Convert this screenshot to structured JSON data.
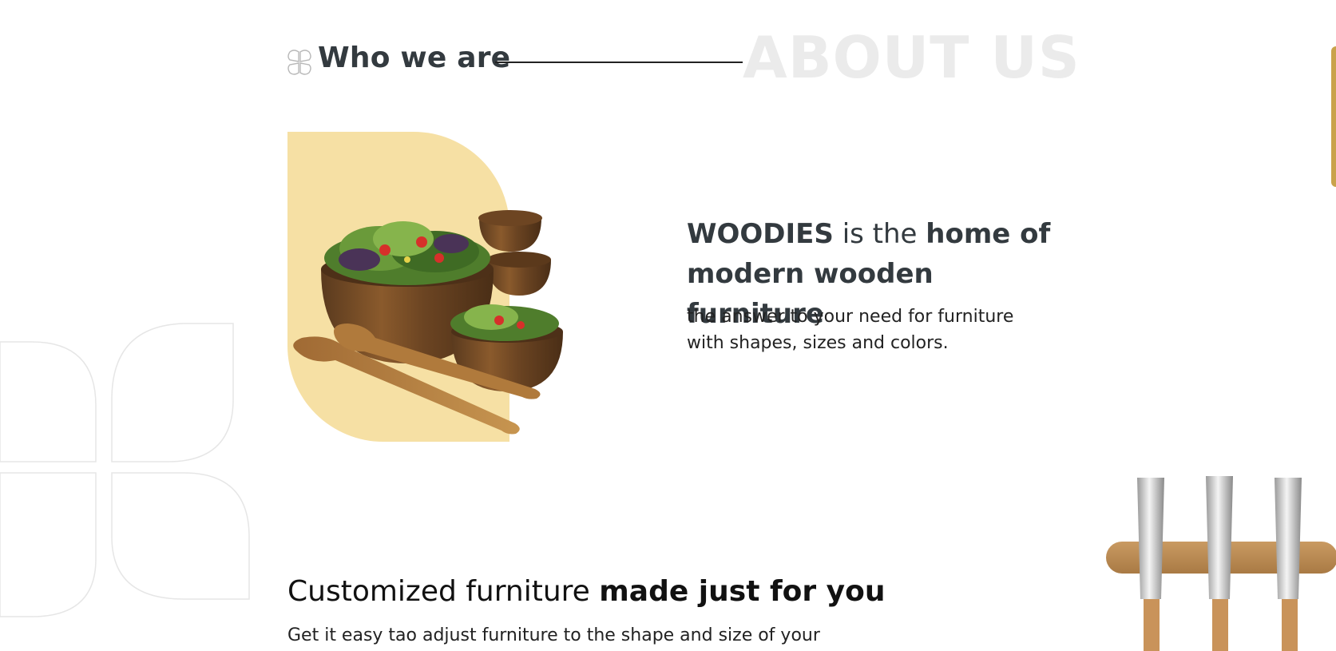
{
  "about": {
    "section_icon": "flower-icon",
    "section_title": "Who we are",
    "background_heading": "ABOUT US"
  },
  "intro": {
    "brand": "WOODIES",
    "headline_mid": " is the ",
    "headline_bold": "home of modern wooden furniture",
    "subtext": "the answer to your need for furniture with shapes, sizes and colors."
  },
  "section2": {
    "heading_regular": "Customized furniture ",
    "heading_bold": "made just for you",
    "text": "Get it easy tao adjust furniture to the shape and size of your"
  },
  "colors": {
    "accent_yellow": "#f6e0a4",
    "edge_tab_gold": "#c9a24b",
    "heading_gray": "#333a3f",
    "watermark_gray": "#ebebeb"
  }
}
